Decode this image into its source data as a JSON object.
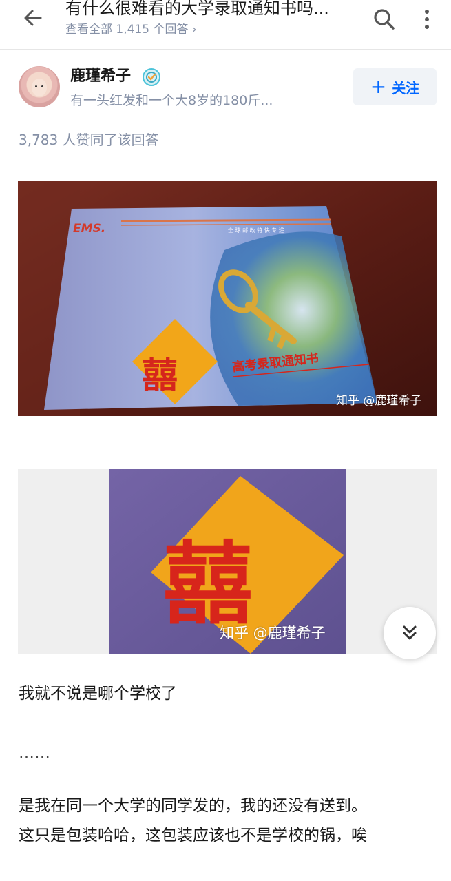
{
  "header": {
    "title": "有什么很难看的大学录取通知书吗...",
    "subtitle": "查看全部 1,415 个回答 ›",
    "icons": {
      "back": "arrow-left-icon",
      "search": "search-icon",
      "more": "more-vertical-icon"
    }
  },
  "author": {
    "name": "鹿瑾希子",
    "bio": "有一头红发和一个大8岁的180斤...",
    "follow_label": "关注",
    "follow_plus": "+"
  },
  "answer": {
    "likes": "3,783 人赞同了该回答",
    "image1": {
      "ems_logo": "EMS.",
      "ems_slogan": "全 球 邮 政 特 快 专 递",
      "xi_char": "囍",
      "caption": "高考录取通知书",
      "watermark": "知乎 @鹿瑾希子"
    },
    "image2": {
      "xi_char": "囍",
      "watermark": "知乎 @鹿瑾希子"
    },
    "paragraphs": [
      "我就不说是哪个学校了",
      "……",
      "是我在同一个大学的同学发的，我的还没有送到。",
      "这只是包装哈哈，这包装应该也不是学校的锅，唉"
    ]
  },
  "colors": {
    "accent": "#0066ff",
    "muted": "#8590a6",
    "follow_bg": "#f0f3f7"
  }
}
